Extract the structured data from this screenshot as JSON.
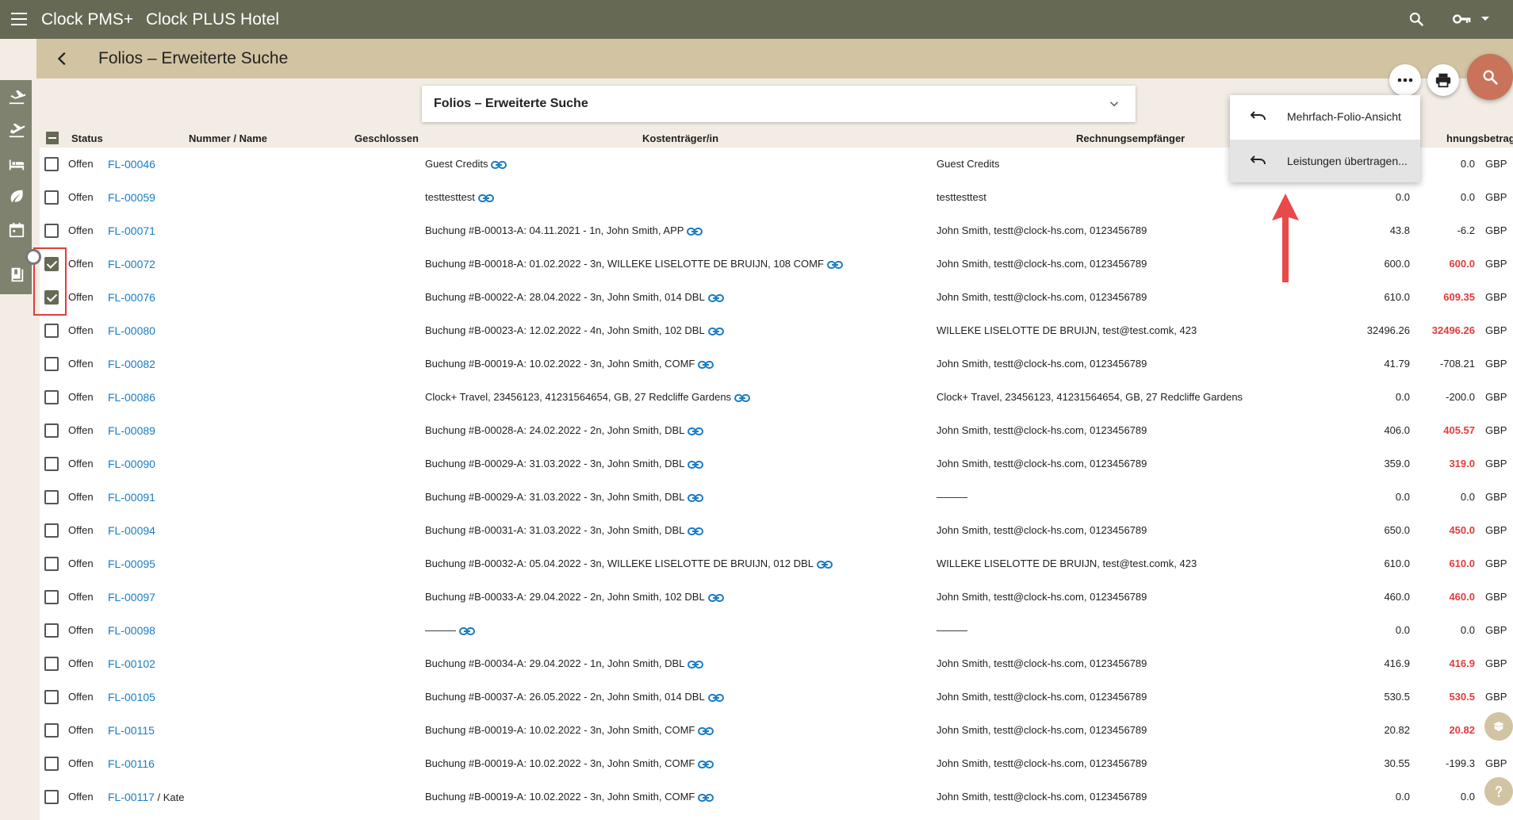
{
  "header": {
    "app_name": "Clock PMS+",
    "hotel_name": "Clock PLUS Hotel"
  },
  "subheader": {
    "title": "Folios – Erweiterte Suche"
  },
  "search_select": {
    "label": "Folios – Erweiterte Suche"
  },
  "table": {
    "columns": {
      "status": "Status",
      "number": "Nummer / Name",
      "closed": "Geschlossen",
      "payer": "Kostenträger/in",
      "recipient": "Rechnungsempfänger",
      "amount": "hnungsbetrag"
    },
    "rows": [
      {
        "status": "Offen",
        "number": "FL-00046",
        "name": "",
        "payer": "Guest Credits",
        "recipient": "Guest Credits",
        "val1": "",
        "val2": "0.0",
        "red": false,
        "cur": "GBP",
        "checked": false
      },
      {
        "status": "Offen",
        "number": "FL-00059",
        "name": "",
        "payer": "testtesttest",
        "recipient": "testtesttest",
        "val1": "0.0",
        "val2": "0.0",
        "red": false,
        "cur": "GBP",
        "checked": false
      },
      {
        "status": "Offen",
        "number": "FL-00071",
        "name": "",
        "payer": "Buchung #B-00013-A: 04.11.2021 - 1n, John Smith, APP",
        "recipient": "John Smith, testt@clock-hs.com, 0123456789",
        "val1": "43.8",
        "val2": "-6.2",
        "red": false,
        "cur": "GBP",
        "checked": false
      },
      {
        "status": "Offen",
        "number": "FL-00072",
        "name": "",
        "payer": "Buchung #B-00018-A: 01.02.2022 - 3n, WILLEKE LISELOTTE DE BRUIJN, 108 COMF",
        "recipient": "John Smith, testt@clock-hs.com, 0123456789",
        "val1": "600.0",
        "val2": "600.0",
        "red": true,
        "cur": "GBP",
        "checked": true
      },
      {
        "status": "Offen",
        "number": "FL-00076",
        "name": "",
        "payer": "Buchung #B-00022-A: 28.04.2022 - 3n, John Smith, 014 DBL",
        "recipient": "John Smith, testt@clock-hs.com, 0123456789",
        "val1": "610.0",
        "val2": "609.35",
        "red": true,
        "cur": "GBP",
        "checked": true
      },
      {
        "status": "Offen",
        "number": "FL-00080",
        "name": "",
        "payer": "Buchung #B-00023-A: 12.02.2022 - 4n, John Smith, 102 DBL",
        "recipient": "WILLEKE LISELOTTE DE BRUIJN, test@test.comk, 423",
        "val1": "32496.26",
        "val2": "32496.26",
        "red": true,
        "cur": "GBP",
        "checked": false
      },
      {
        "status": "Offen",
        "number": "FL-00082",
        "name": "",
        "payer": "Buchung #B-00019-A: 10.02.2022 - 3n, John Smith, COMF",
        "recipient": "John Smith, testt@clock-hs.com, 0123456789",
        "val1": "41.79",
        "val2": "-708.21",
        "red": false,
        "cur": "GBP",
        "checked": false
      },
      {
        "status": "Offen",
        "number": "FL-00086",
        "name": "",
        "payer": "Clock+ Travel, 23456123, 41231564654, GB, 27 Redcliffe Gardens",
        "recipient": "Clock+ Travel, 23456123, 41231564654, GB, 27 Redcliffe Gardens",
        "val1": "0.0",
        "val2": "-200.0",
        "red": false,
        "cur": "GBP",
        "checked": false
      },
      {
        "status": "Offen",
        "number": "FL-00089",
        "name": "",
        "payer": "Buchung #B-00028-A: 24.02.2022 - 2n, John Smith, DBL",
        "recipient": "John Smith, testt@clock-hs.com, 0123456789",
        "val1": "406.0",
        "val2": "405.57",
        "red": true,
        "cur": "GBP",
        "checked": false
      },
      {
        "status": "Offen",
        "number": "FL-00090",
        "name": "",
        "payer": "Buchung #B-00029-A: 31.03.2022 - 3n, John Smith, DBL",
        "recipient": "John Smith, testt@clock-hs.com, 0123456789",
        "val1": "359.0",
        "val2": "319.0",
        "red": true,
        "cur": "GBP",
        "checked": false
      },
      {
        "status": "Offen",
        "number": "FL-00091",
        "name": "",
        "payer": "Buchung #B-00029-A: 31.03.2022 - 3n, John Smith, DBL",
        "recipient": "———",
        "val1": "0.0",
        "val2": "0.0",
        "red": false,
        "cur": "GBP",
        "checked": false
      },
      {
        "status": "Offen",
        "number": "FL-00094",
        "name": "",
        "payer": "Buchung #B-00031-A: 31.03.2022 - 3n, John Smith, DBL",
        "recipient": "John Smith, testt@clock-hs.com, 0123456789",
        "val1": "650.0",
        "val2": "450.0",
        "red": true,
        "cur": "GBP",
        "checked": false
      },
      {
        "status": "Offen",
        "number": "FL-00095",
        "name": "",
        "payer": "Buchung #B-00032-A: 05.04.2022 - 3n, WILLEKE LISELOTTE DE BRUIJN, 012 DBL",
        "recipient": "WILLEKE LISELOTTE DE BRUIJN, test@test.comk, 423",
        "val1": "610.0",
        "val2": "610.0",
        "red": true,
        "cur": "GBP",
        "checked": false
      },
      {
        "status": "Offen",
        "number": "FL-00097",
        "name": "",
        "payer": "Buchung #B-00033-A: 29.04.2022 - 2n, John Smith, 102 DBL",
        "recipient": "John Smith, testt@clock-hs.com, 0123456789",
        "val1": "460.0",
        "val2": "460.0",
        "red": true,
        "cur": "GBP",
        "checked": false
      },
      {
        "status": "Offen",
        "number": "FL-00098",
        "name": "",
        "payer": "———",
        "recipient": "———",
        "val1": "0.0",
        "val2": "0.0",
        "red": false,
        "cur": "GBP",
        "checked": false
      },
      {
        "status": "Offen",
        "number": "FL-00102",
        "name": "",
        "payer": "Buchung #B-00034-A: 29.04.2022 - 1n, John Smith, DBL",
        "recipient": "John Smith, testt@clock-hs.com, 0123456789",
        "val1": "416.9",
        "val2": "416.9",
        "red": true,
        "cur": "GBP",
        "checked": false
      },
      {
        "status": "Offen",
        "number": "FL-00105",
        "name": "",
        "payer": "Buchung #B-00037-A: 26.05.2022 - 2n, John Smith, 014 DBL",
        "recipient": "John Smith, testt@clock-hs.com, 0123456789",
        "val1": "530.5",
        "val2": "530.5",
        "red": true,
        "cur": "GBP",
        "checked": false
      },
      {
        "status": "Offen",
        "number": "FL-00115",
        "name": "",
        "payer": "Buchung #B-00019-A: 10.02.2022 - 3n, John Smith, COMF",
        "recipient": "John Smith, testt@clock-hs.com, 0123456789",
        "val1": "20.82",
        "val2": "20.82",
        "red": true,
        "cur": "",
        "checked": false
      },
      {
        "status": "Offen",
        "number": "FL-00116",
        "name": "",
        "payer": "Buchung #B-00019-A: 10.02.2022 - 3n, John Smith, COMF",
        "recipient": "John Smith, testt@clock-hs.com, 0123456789",
        "val1": "30.55",
        "val2": "-199.3",
        "red": false,
        "cur": "GBP",
        "checked": false
      },
      {
        "status": "Offen",
        "number": "FL-00117",
        "name": " / Kate",
        "payer": "Buchung #B-00019-A: 10.02.2022 - 3n, John Smith, COMF",
        "recipient": "John Smith, testt@clock-hs.com, 0123456789",
        "val1": "0.0",
        "val2": "0.0",
        "red": false,
        "cur": "",
        "checked": false
      }
    ]
  },
  "menu": {
    "items": [
      {
        "label": "Mehrfach-Folio-Ansicht"
      },
      {
        "label": "Leistungen übertragen..."
      }
    ]
  },
  "colors": {
    "topbar": "#666a55",
    "subheader": "#d2c4a2",
    "link": "#1a7cc4",
    "negative": "#e23c3c",
    "accent_fab": "#c9735a"
  },
  "icons": [
    "menu-icon",
    "search-icon",
    "key-icon",
    "arrival-icon",
    "departure-icon",
    "bed-icon",
    "leaf-icon",
    "calendar-icon",
    "book-icon",
    "back-arrow-icon",
    "more-icon",
    "print-icon",
    "chevron-down-icon",
    "link-icon",
    "undo-icon",
    "help-icon"
  ]
}
